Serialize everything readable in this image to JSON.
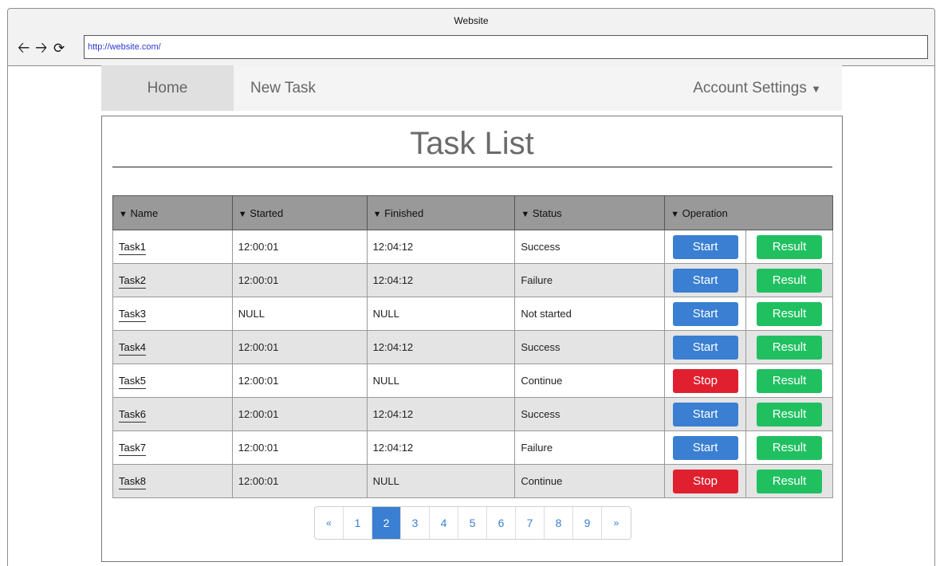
{
  "window": {
    "title": "Website"
  },
  "toolbar": {
    "url": "http://website.com/"
  },
  "nav": {
    "home": "Home",
    "new_task": "New Task",
    "account": "Account Settings",
    "account_caret": "▼"
  },
  "page": {
    "title": "Task List"
  },
  "table": {
    "headers": [
      "Name",
      "Started",
      "Finished",
      "Status",
      "Operation"
    ],
    "rows": [
      {
        "name": "Task1",
        "started": "12:00:01",
        "finished": "12:04:12",
        "status": "Success",
        "action": "Start",
        "result": "Result"
      },
      {
        "name": "Task2",
        "started": "12:00:01",
        "finished": "12:04:12",
        "status": "Failure",
        "action": "Start",
        "result": "Result"
      },
      {
        "name": "Task3",
        "started": "NULL",
        "finished": "NULL",
        "status": "Not started",
        "action": "Start",
        "result": "Result"
      },
      {
        "name": "Task4",
        "started": "12:00:01",
        "finished": "12:04:12",
        "status": "Success",
        "action": "Start",
        "result": "Result"
      },
      {
        "name": "Task5",
        "started": "12:00:01",
        "finished": "NULL",
        "status": "Continue",
        "action": "Stop",
        "result": "Result"
      },
      {
        "name": "Task6",
        "started": "12:00:01",
        "finished": "12:04:12",
        "status": "Success",
        "action": "Start",
        "result": "Result"
      },
      {
        "name": "Task7",
        "started": "12:00:01",
        "finished": "12:04:12",
        "status": "Failure",
        "action": "Start",
        "result": "Result"
      },
      {
        "name": "Task8",
        "started": "12:00:01",
        "finished": "NULL",
        "status": "Continue",
        "action": "Stop",
        "result": "Result"
      }
    ]
  },
  "pagination": {
    "prev": "«",
    "next": "»",
    "pages": [
      "1",
      "2",
      "3",
      "4",
      "5",
      "6",
      "7",
      "8",
      "9"
    ],
    "active": "2"
  },
  "colors": {
    "start": "#3a7fd1",
    "stop": "#e0202f",
    "result": "#20c060",
    "header": "#999999"
  },
  "icons": [
    "back-arrow-icon",
    "forward-arrow-icon",
    "reload-icon",
    "sort-triangle-icon",
    "chevron-down-icon"
  ]
}
